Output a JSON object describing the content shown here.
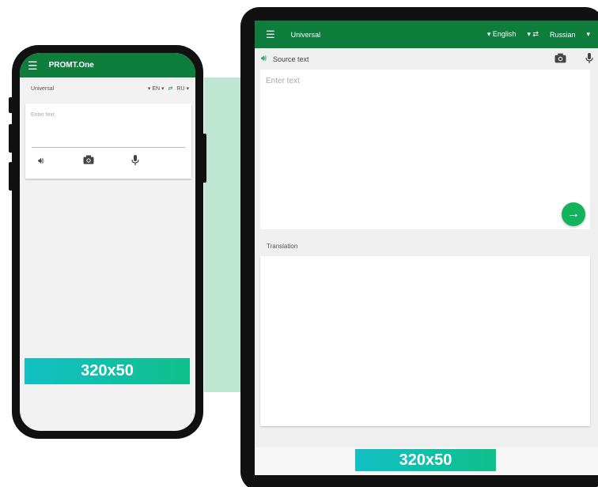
{
  "phone": {
    "app_title": "PROMT.One",
    "menu_icon": "menu-icon",
    "mode": "Universal",
    "source_lang": "EN",
    "target_lang": "RU",
    "placeholder": "Enter text",
    "ad_label": "320x50"
  },
  "tablet": {
    "mode": "Universal",
    "source_lang": "English",
    "target_lang": "Russian",
    "source_label": "Source text",
    "placeholder": "Enter text",
    "translation_label": "Translation",
    "ad_label": "320x50"
  },
  "colors": {
    "brand_green": "#0f7d3b",
    "accent_green": "#13b35e",
    "ad_gradient_start": "#12c0c6",
    "ad_gradient_end": "#0fc08a",
    "connector": "#bfe6d3"
  }
}
